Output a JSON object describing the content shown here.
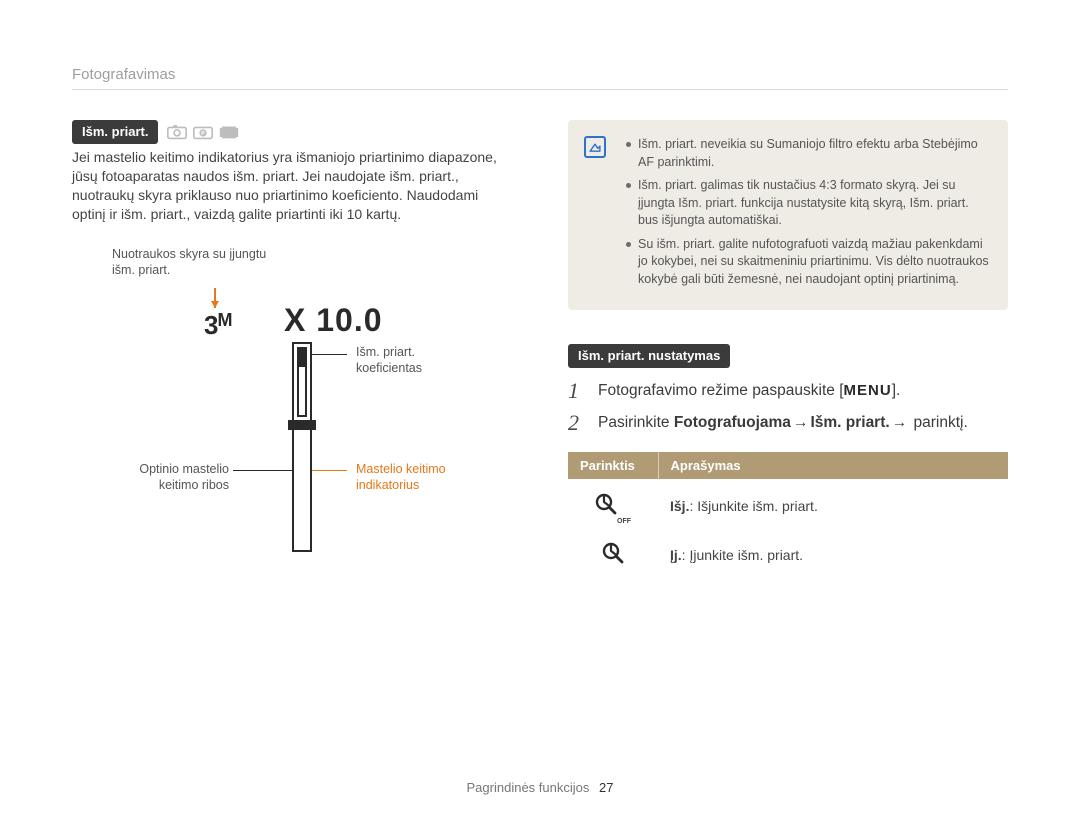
{
  "breadcrumb": "Fotografavimas",
  "left": {
    "heading": "Išm. priart.",
    "paragraph": "Jei mastelio keitimo indikatorius yra išmaniojo priartinimo diapazone, jūsų fotoaparatas naudos išm. priart. Jei naudojate išm. priart., nuotraukų skyra priklauso nuo priartinimo koeficiento. Naudodami optinį ir išm. priart., vaizdą galite priartinti iki 10 kartų.",
    "diagram": {
      "topCaption": "Nuotraukos skyra su įjungtu išm. priart.",
      "resLabel": "3",
      "resUnit": "M",
      "zoomLabel": "X 10.0",
      "coefCaption": "Išm. priart. koeficientas",
      "opticalCaption": "Optinio mastelio keitimo ribos",
      "indicatorCaption": "Mastelio keitimo indikatorius"
    }
  },
  "right": {
    "notes": [
      "Išm. priart. neveikia su Sumaniojo filtro efektu arba Stebėjimo AF parinktimi.",
      "Išm. priart. galimas tik nustačius 4:3 formato skyrą. Jei su įjungta Išm. priart. funkcija nustatysite kitą skyrą, Išm. priart. bus išjungta automatiškai.",
      "Su išm. priart. galite nufotografuoti vaizdą mažiau pakenkdami jo kokybei, nei su skaitmeniniu priartinimu. Vis dėlto nuotraukos kokybė gali būti žemesnė, nei naudojant optinį priartinimą."
    ],
    "settingHeading": "Išm. priart. nustatymas",
    "step1_pre": "Fotografavimo režime paspauskite [",
    "step1_menu": "MENU",
    "step1_post": "].",
    "step2_pre": "Pasirinkite ",
    "step2_b1": "Fotografuojama",
    "step2_arrow": "→",
    "step2_b2": "Išm. priart.",
    "step2_post": " parinktį.",
    "table": {
      "h1": "Parinktis",
      "h2": "Aprašymas",
      "row1_label": "Išj.",
      "row1_text": ": Išjunkite išm. priart.",
      "row2_label": "Įj.",
      "row2_text": ": Įjunkite išm. priart."
    }
  },
  "footer": {
    "text": "Pagrindinės funkcijos",
    "page": "27"
  }
}
